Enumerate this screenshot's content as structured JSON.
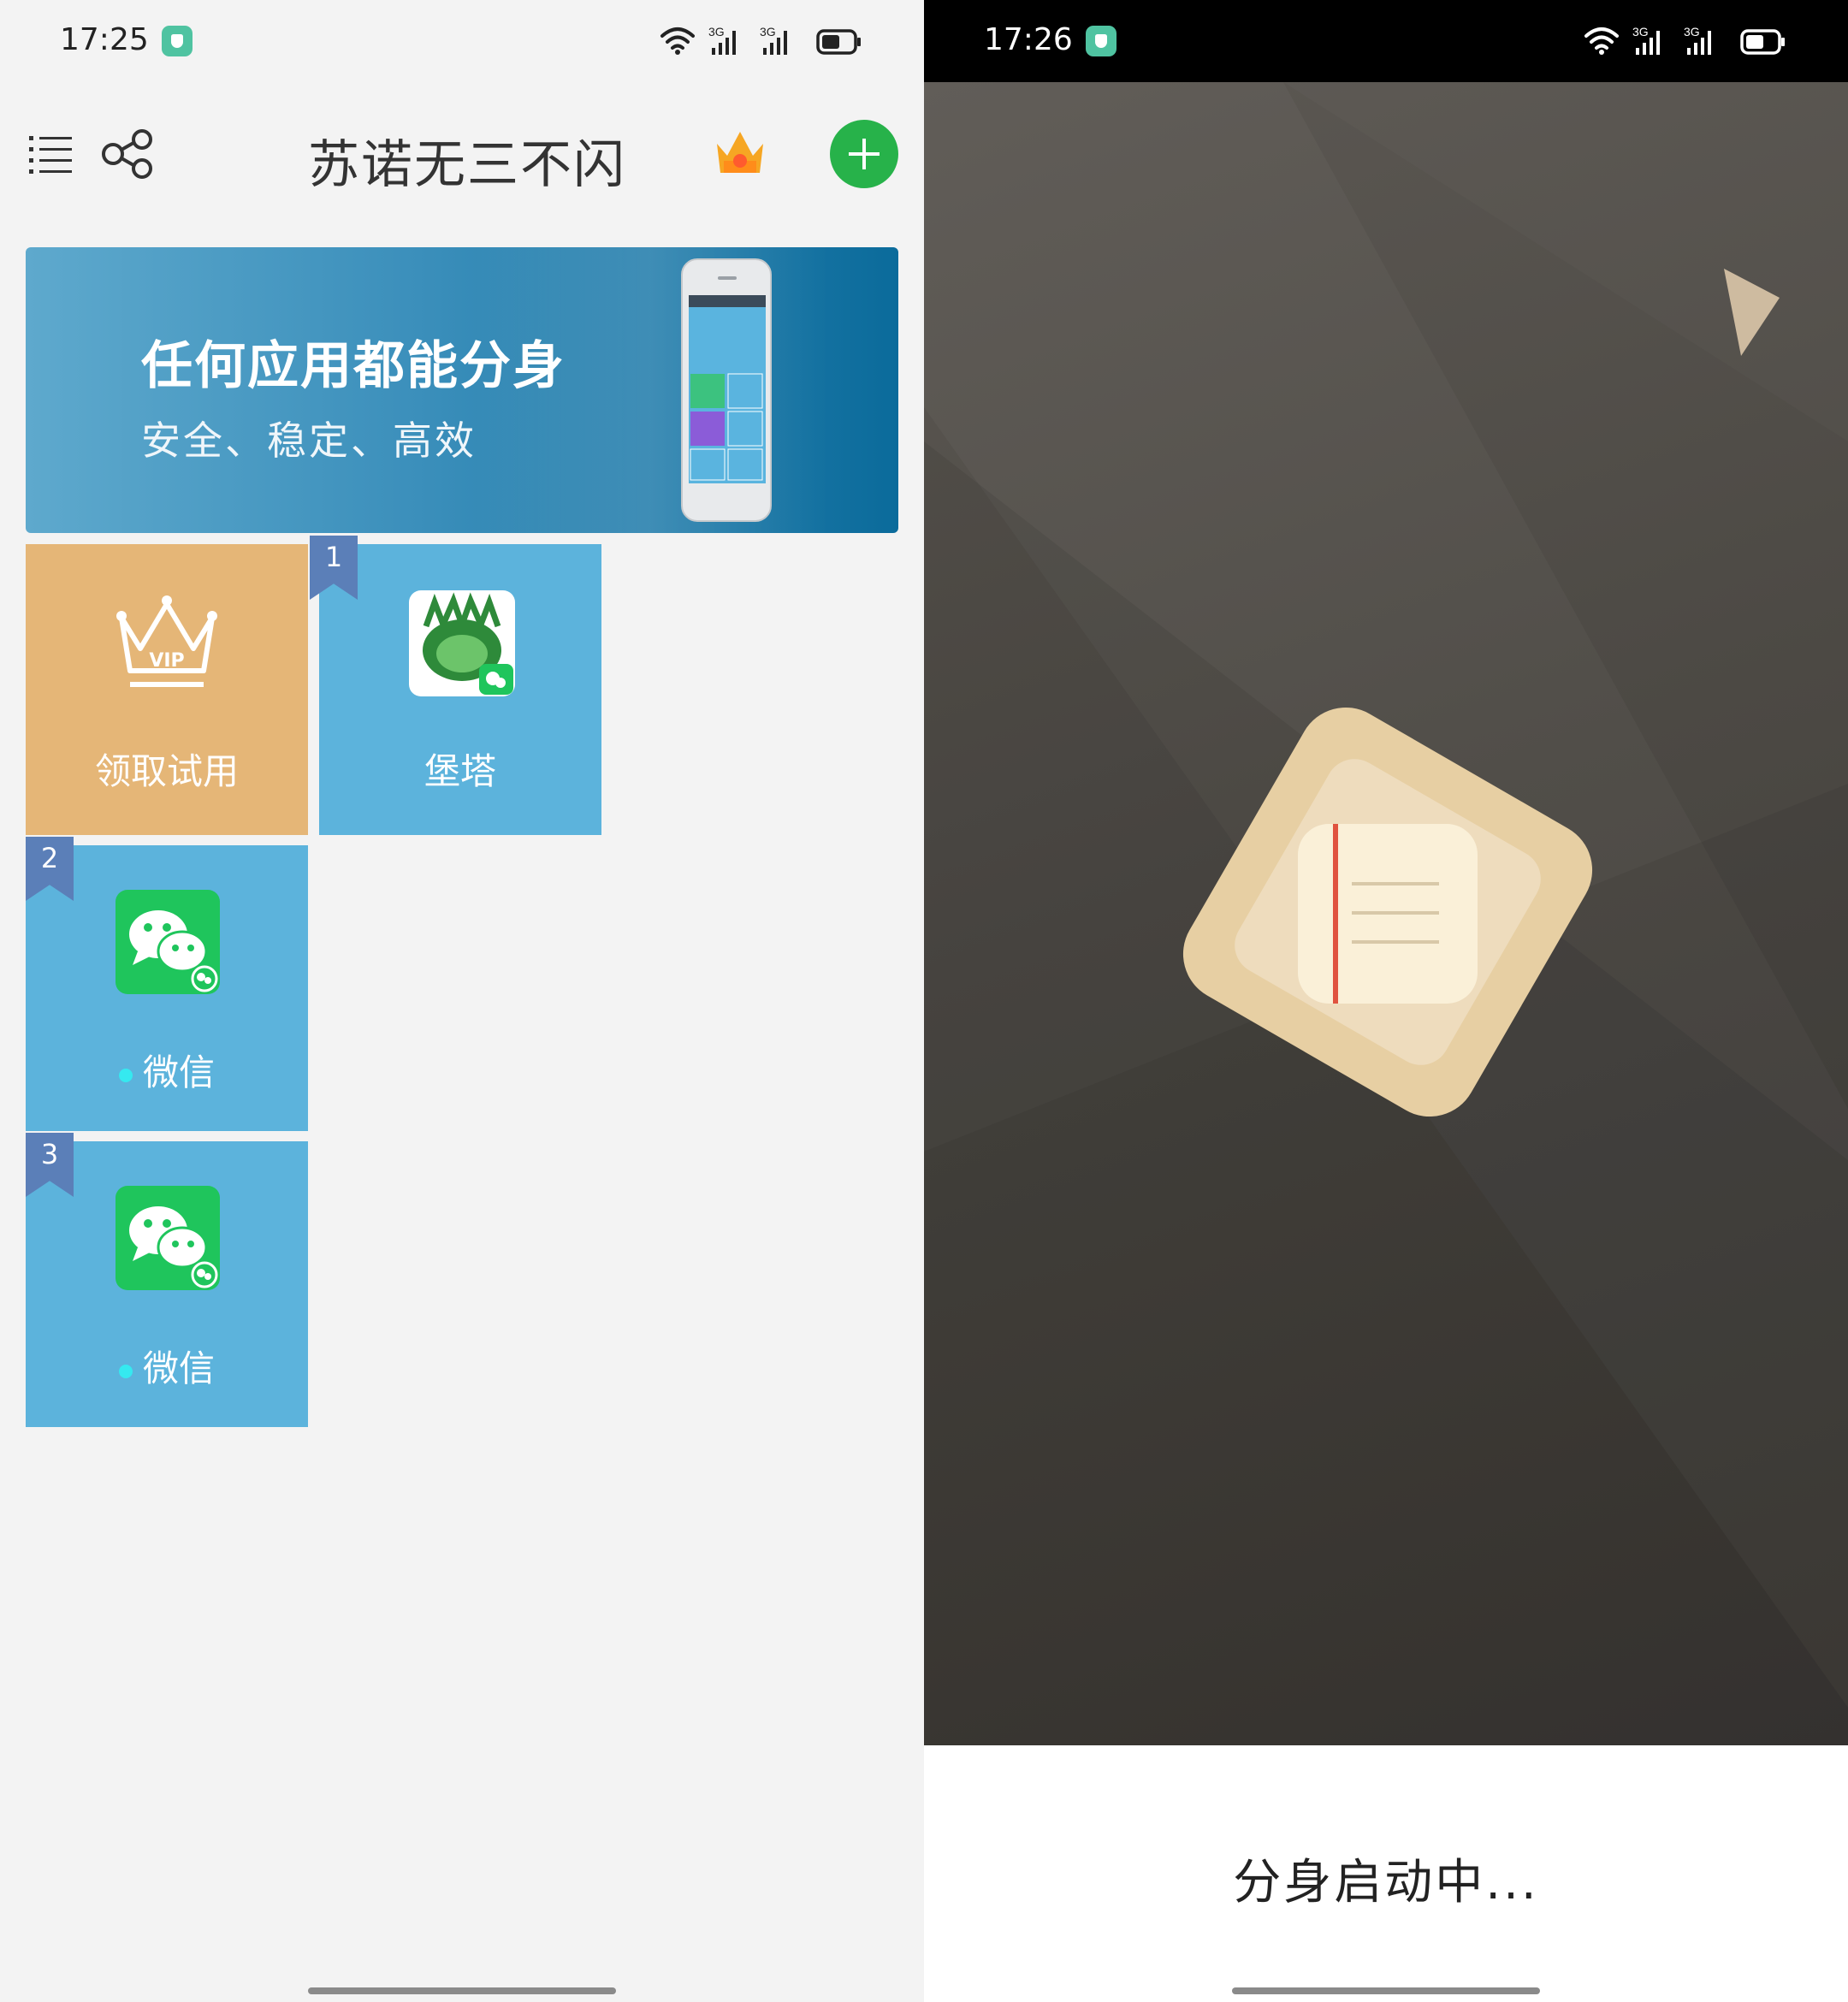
{
  "left": {
    "status": {
      "time": "17:25"
    },
    "header": {
      "title": "苏诺无三不闪"
    },
    "banner": {
      "headline": "任何应用都能分身",
      "subline": "安全、稳定、高效"
    },
    "tiles": [
      {
        "label": "领取试用"
      },
      {
        "badge": "1",
        "label": "堡塔"
      },
      {
        "badge": "2",
        "label": "微信"
      },
      {
        "badge": "3",
        "label": "微信"
      }
    ]
  },
  "right": {
    "status": {
      "time": "17:26"
    },
    "loading_text": "分身启动中..."
  },
  "colors": {
    "tile_blue": "#5cb3dc",
    "tile_gold": "#e5b677",
    "add_green": "#27b24a",
    "badge_blue": "#5b7fb8",
    "online_dot": "#35e9f0"
  }
}
